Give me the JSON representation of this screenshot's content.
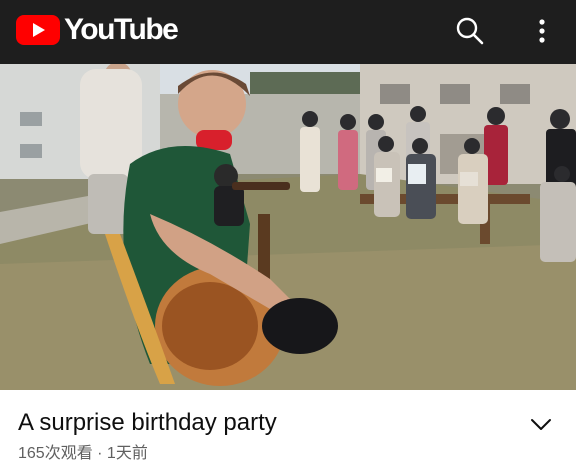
{
  "app": {
    "name": "YouTube",
    "brand_color": "#ff0000",
    "header_bg": "#1e1e1e"
  },
  "header": {
    "logo_text": "YouTube",
    "icons": [
      "youtube-logo-icon",
      "search-icon",
      "more-vert-icon"
    ]
  },
  "video": {
    "thumbnail": "group of students sitting on benches on a lawn while a man in a green shirt plays acoustic guitar"
  },
  "info": {
    "title": "A surprise birthday party",
    "views": "165次观看",
    "separator": " · ",
    "age": "1天前",
    "expand_icon": "chevron-down-icon"
  }
}
